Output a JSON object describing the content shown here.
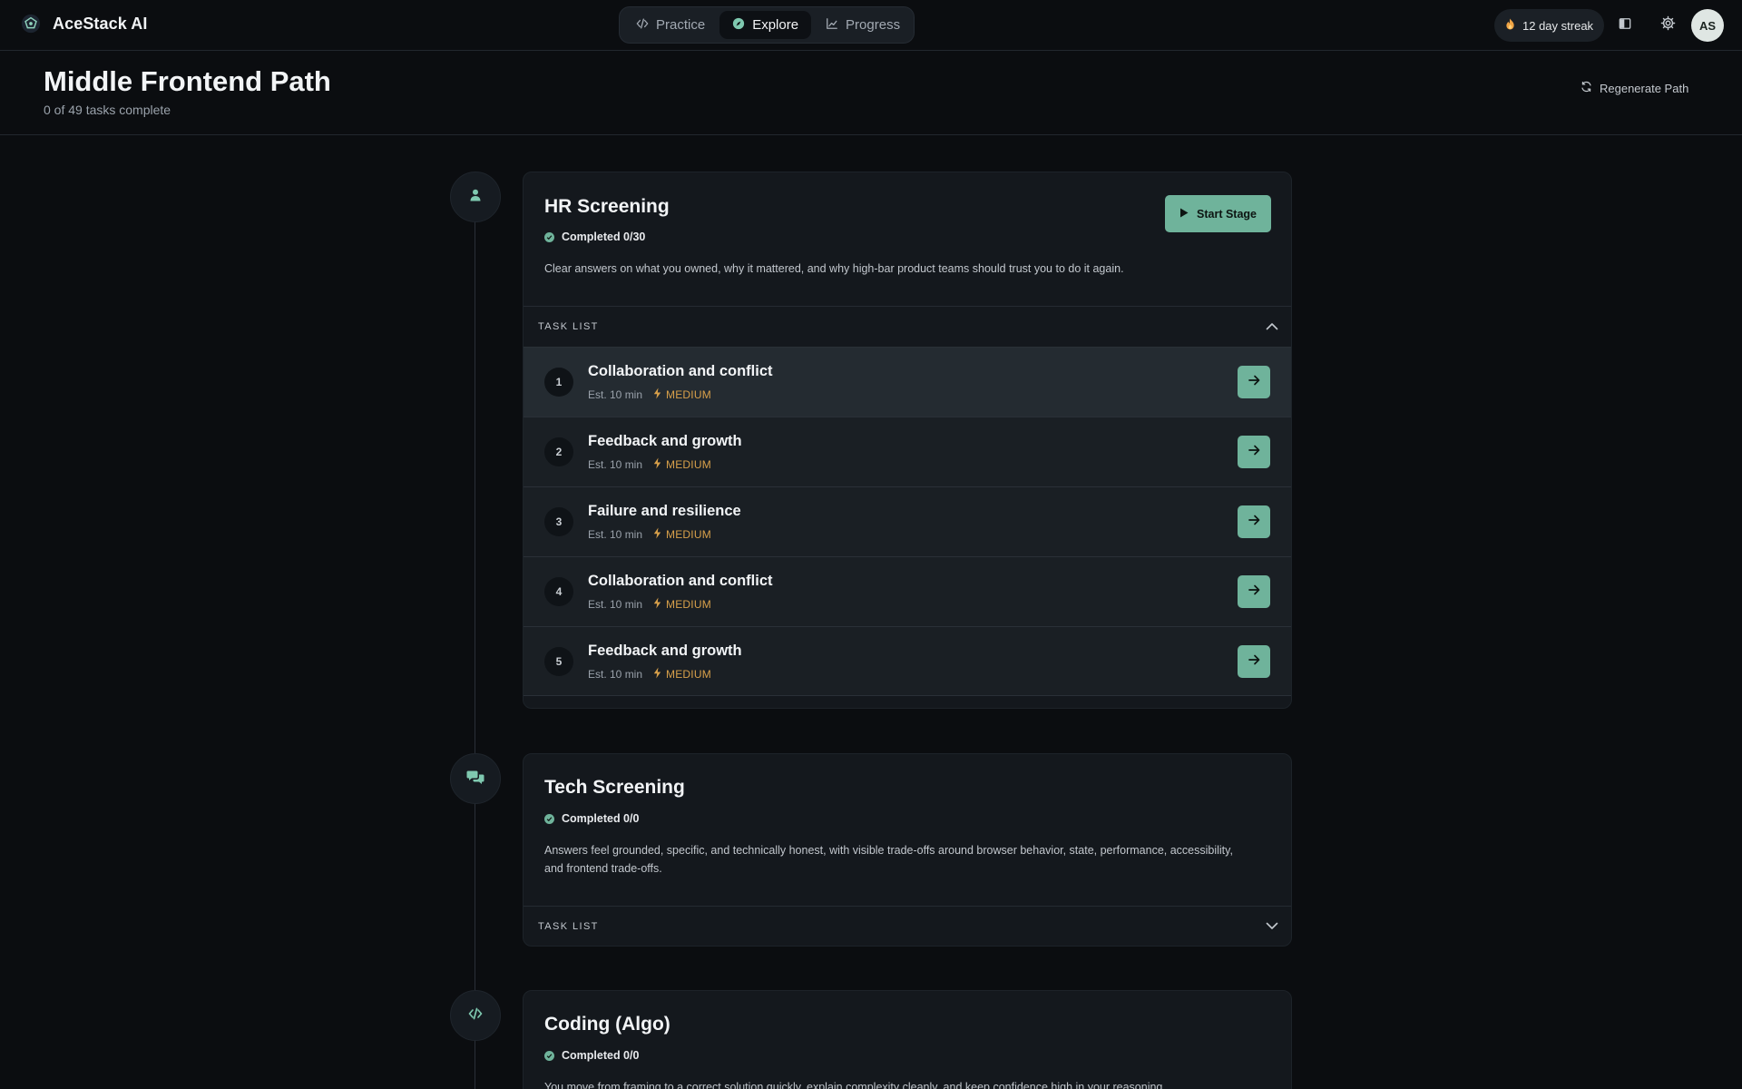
{
  "app": {
    "name": "AceStack AI"
  },
  "nav": {
    "items": [
      {
        "label": "Practice",
        "icon": "code-icon",
        "active": false
      },
      {
        "label": "Explore",
        "icon": "compass-icon",
        "active": true
      },
      {
        "label": "Progress",
        "icon": "chart-line-icon",
        "active": false
      }
    ]
  },
  "topbar": {
    "streak_label": "12 day streak",
    "avatar_initials": "AS"
  },
  "page": {
    "title": "Middle Frontend Path",
    "subtitle": "0 of 49 tasks complete",
    "regenerate_label": "Regenerate Path"
  },
  "stages": [
    {
      "title": "HR Screening",
      "completed": "Completed 0/30",
      "description": "Clear answers on what you owned, why it mattered, and why high-bar product teams should trust you to do it again.",
      "start_label": "Start Stage",
      "tasklist_label": "TASK LIST",
      "icon": "person-icon",
      "tasks": [
        {
          "num": "1",
          "title": "Collaboration and conflict",
          "est": "Est. 10 min",
          "difficulty": "MEDIUM"
        },
        {
          "num": "2",
          "title": "Feedback and growth",
          "est": "Est. 10 min",
          "difficulty": "MEDIUM"
        },
        {
          "num": "3",
          "title": "Failure and resilience",
          "est": "Est. 10 min",
          "difficulty": "MEDIUM"
        },
        {
          "num": "4",
          "title": "Collaboration and conflict",
          "est": "Est. 10 min",
          "difficulty": "MEDIUM"
        },
        {
          "num": "5",
          "title": "Feedback and growth",
          "est": "Est. 10 min",
          "difficulty": "MEDIUM"
        }
      ]
    },
    {
      "title": "Tech Screening",
      "completed": "Completed 0/0",
      "description": "Answers feel grounded, specific, and technically honest, with visible trade-offs around browser behavior, state, performance, accessibility, and frontend trade-offs.",
      "tasklist_label": "TASK LIST",
      "icon": "chat-bubbles-icon"
    },
    {
      "title": "Coding (Algo)",
      "completed": "Completed 0/0",
      "description": "You move from framing to a correct solution quickly, explain complexity cleanly, and keep confidence high in your reasoning.",
      "icon": "code-icon"
    }
  ],
  "colors": {
    "accent": "#6fb39b",
    "warning": "#d8a04a",
    "background": "#0b0d10",
    "card": "#14181d"
  }
}
